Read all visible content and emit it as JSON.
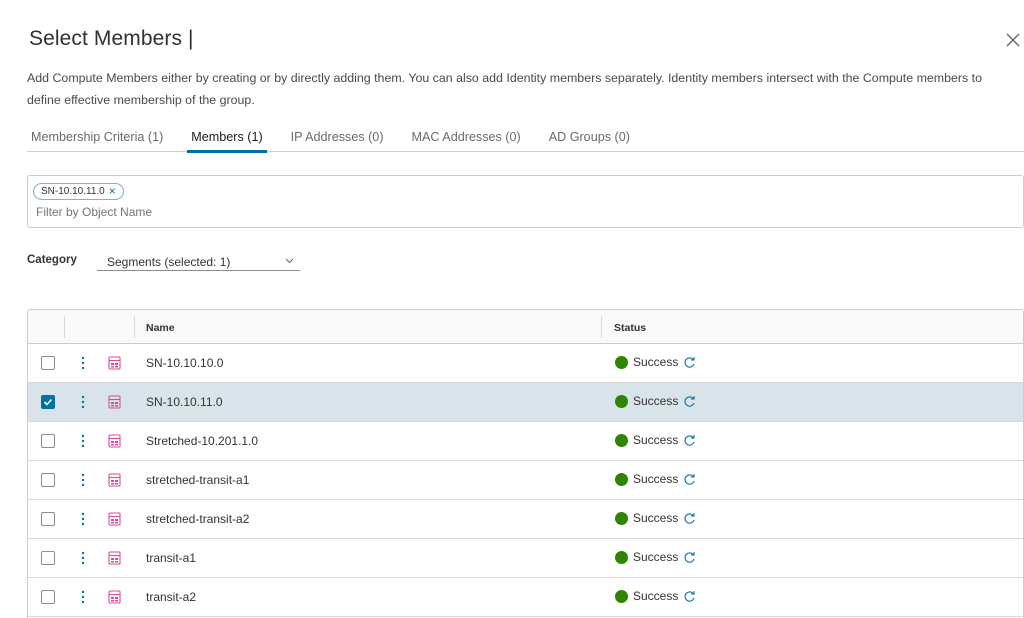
{
  "header": {
    "title": "Select Members |"
  },
  "description": "Add Compute Members either by creating or by directly adding them. You can also add Identity members separately. Identity members intersect with the Compute members to define effective membership of the group.",
  "tabs": [
    {
      "label": "Membership Criteria (1)",
      "active": false
    },
    {
      "label": "Members (1)",
      "active": true
    },
    {
      "label": "IP Addresses (0)",
      "active": false
    },
    {
      "label": "MAC Addresses (0)",
      "active": false
    },
    {
      "label": "AD Groups (0)",
      "active": false
    }
  ],
  "filter": {
    "chip": "SN-10.10.11.0",
    "placeholder": "Filter by Object Name"
  },
  "category": {
    "label": "Category",
    "value": "Segments (selected: 1)"
  },
  "grid": {
    "columns": {
      "name": "Name",
      "status": "Status"
    },
    "rows": [
      {
        "name": "SN-10.10.10.0",
        "status": "Success",
        "checked": false
      },
      {
        "name": "SN-10.10.11.0",
        "status": "Success",
        "checked": true
      },
      {
        "name": "Stretched-10.201.1.0",
        "status": "Success",
        "checked": false
      },
      {
        "name": "stretched-transit-a1",
        "status": "Success",
        "checked": false
      },
      {
        "name": "stretched-transit-a2",
        "status": "Success",
        "checked": false
      },
      {
        "name": "transit-a1",
        "status": "Success",
        "checked": false
      },
      {
        "name": "transit-a2",
        "status": "Success",
        "checked": false
      }
    ]
  },
  "icons": {
    "close": "close-icon",
    "segment": "segment-icon",
    "status": "status-success-icon",
    "refresh": "refresh-icon",
    "menu": "kebab-menu-icon",
    "dropdown": "chevron-down-icon"
  },
  "colors": {
    "accent": "#0072a3",
    "success": "#2f8400",
    "segment_icon": "#e0489a",
    "selected_row": "#d9e4ea"
  }
}
